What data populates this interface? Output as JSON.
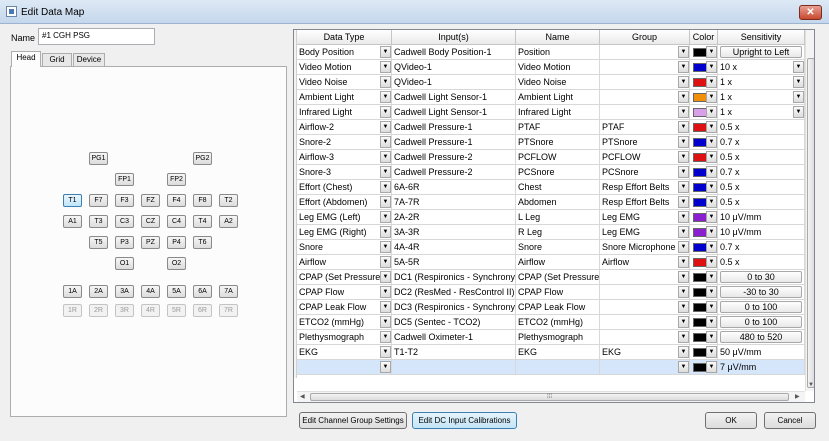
{
  "window": {
    "title": "Edit Data Map",
    "close_glyph": "✕"
  },
  "name_field": {
    "label": "Name",
    "value": "#1 CGH PSG"
  },
  "tabs": [
    "Head",
    "Grid",
    "Device"
  ],
  "electrodes": {
    "row1": [
      "PG1",
      "PG2"
    ],
    "row2": [
      "FP1",
      "FP2"
    ],
    "row3": [
      "T1",
      "F7",
      "F3",
      "FZ",
      "F4",
      "F8",
      "T2"
    ],
    "row4": [
      "A1",
      "T3",
      "C3",
      "CZ",
      "C4",
      "T4",
      "A2"
    ],
    "row5": [
      "T5",
      "P3",
      "PZ",
      "P4",
      "T6"
    ],
    "row6": [
      "O1",
      "O2"
    ],
    "row7": [
      "1A",
      "2A",
      "3A",
      "4A",
      "5A",
      "6A",
      "7A"
    ],
    "row8": [
      "1R",
      "2R",
      "3R",
      "4R",
      "5R",
      "6R",
      "7R"
    ]
  },
  "table": {
    "headers": [
      "Data Type",
      "Input(s)",
      "Name",
      "Group",
      "Color",
      "Sensitivity"
    ],
    "rows": [
      {
        "type": "Body Position",
        "input": "Cadwell Body Position-1",
        "name": "Position",
        "group": "",
        "color": "#000000",
        "sens": "Upright to Left",
        "sens_style": "button"
      },
      {
        "type": "Video Motion",
        "input": "QVideo-1",
        "name": "Video Motion",
        "group": "",
        "color": "#0000cc",
        "sens": "10 x",
        "sens_style": "dropdown"
      },
      {
        "type": "Video Noise",
        "input": "QVideo-1",
        "name": "Video Noise",
        "group": "",
        "color": "#dd1111",
        "sens": "1 x",
        "sens_style": "dropdown"
      },
      {
        "type": "Ambient Light",
        "input": "Cadwell Light Sensor-1",
        "name": "Ambient Light",
        "group": "",
        "color": "#f0900a",
        "sens": "1 x",
        "sens_style": "dropdown"
      },
      {
        "type": "Infrared Light",
        "input": "Cadwell Light Sensor-1",
        "name": "Infrared Light",
        "group": "",
        "color": "#d8a0e8",
        "sens": "1 x",
        "sens_style": "dropdown"
      },
      {
        "type": "Airflow-2",
        "input": "Cadwell Pressure-1",
        "name": "PTAF",
        "group": "PTAF",
        "color": "#dd1111",
        "sens": "0.5 x",
        "sens_style": "text"
      },
      {
        "type": "Snore-2",
        "input": "Cadwell Pressure-1",
        "name": "PTSnore",
        "group": "PTSnore",
        "color": "#0000cc",
        "sens": "0.7 x",
        "sens_style": "text"
      },
      {
        "type": "Airflow-3",
        "input": "Cadwell Pressure-2",
        "name": "PCFLOW",
        "group": "PCFLOW",
        "color": "#dd1111",
        "sens": "0.5 x",
        "sens_style": "text"
      },
      {
        "type": "Snore-3",
        "input": "Cadwell Pressure-2",
        "name": "PCSnore",
        "group": "PCSnore",
        "color": "#0000cc",
        "sens": "0.7 x",
        "sens_style": "text"
      },
      {
        "type": "Effort (Chest)",
        "input": "6A-6R",
        "name": "Chest",
        "group": "Resp Effort Belts",
        "color": "#0000cc",
        "sens": "0.5 x",
        "sens_style": "text"
      },
      {
        "type": "Effort (Abdomen)",
        "input": "7A-7R",
        "name": "Abdomen",
        "group": "Resp Effort Belts",
        "color": "#0000cc",
        "sens": "0.5 x",
        "sens_style": "text"
      },
      {
        "type": "Leg EMG (Left)",
        "input": "2A-2R",
        "name": "L Leg",
        "group": "Leg EMG",
        "color": "#8a1fd0",
        "sens": "10 μV/mm",
        "sens_style": "text"
      },
      {
        "type": "Leg EMG (Right)",
        "input": "3A-3R",
        "name": "R Leg",
        "group": "Leg EMG",
        "color": "#8a1fd0",
        "sens": "10 μV/mm",
        "sens_style": "text"
      },
      {
        "type": "Snore",
        "input": "4A-4R",
        "name": "Snore",
        "group": "Snore Microphone",
        "color": "#0000cc",
        "sens": "0.7 x",
        "sens_style": "text"
      },
      {
        "type": "Airflow",
        "input": "5A-5R",
        "name": "Airflow",
        "group": "Airflow",
        "color": "#dd1111",
        "sens": "0.5 x",
        "sens_style": "text"
      },
      {
        "type": "CPAP (Set Pressure)",
        "input": "DC1 (Respironics - Synchrony)",
        "name": "CPAP (Set Pressure)",
        "group": "",
        "color": "#000000",
        "sens": "0 to 30",
        "sens_style": "button"
      },
      {
        "type": "CPAP Flow",
        "input": "DC2 (ResMed - ResControl II)",
        "name": "CPAP Flow",
        "group": "",
        "color": "#000000",
        "sens": "-30 to 30",
        "sens_style": "button"
      },
      {
        "type": "CPAP Leak Flow",
        "input": "DC3 (Respironics - Synchrony)",
        "name": "CPAP Leak Flow",
        "group": "",
        "color": "#000000",
        "sens": "0 to 100",
        "sens_style": "button"
      },
      {
        "type": "ETCO2 (mmHg)",
        "input": "DC5 (Sentec - TCO2)",
        "name": "ETCO2 (mmHg)",
        "group": "",
        "color": "#000000",
        "sens": "0 to 100",
        "sens_style": "button"
      },
      {
        "type": "Plethysmograph",
        "input": "Cadwell Oximeter-1",
        "name": "Plethysmograph",
        "group": "",
        "color": "#000000",
        "sens": "480 to 520",
        "sens_style": "button"
      },
      {
        "type": "EKG",
        "input": "T1-T2",
        "name": "EKG",
        "group": "EKG",
        "color": "#000000",
        "sens": "50 μV/mm",
        "sens_style": "text"
      },
      {
        "type": "",
        "input": "",
        "name": "",
        "group": "",
        "color": "#000000",
        "sens": "7 μV/mm",
        "sens_style": "text",
        "selected": true
      }
    ]
  },
  "buttons": {
    "group_settings": "Edit Channel Group Settings",
    "dc_calibrations": "Edit DC Input Calibrations",
    "ok": "OK",
    "cancel": "Cancel"
  },
  "icons": {
    "dropdown": "chevron-down-icon",
    "close": "close-icon",
    "scroll_left": "scroll-left-icon",
    "scroll_right": "scroll-right-icon",
    "scroll_down": "scroll-down-icon"
  }
}
